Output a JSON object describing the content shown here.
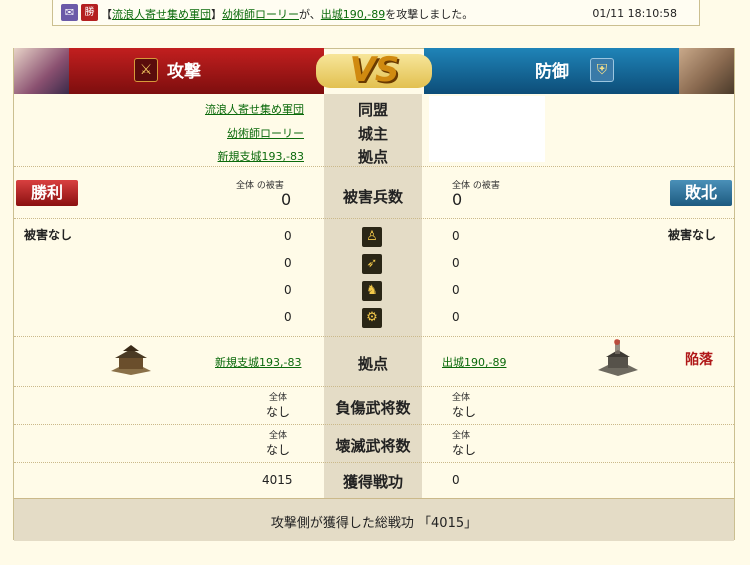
{
  "log": {
    "icon_mail": "✉",
    "icon_win": "勝",
    "prefix": "【",
    "alliance": "流浪人寄せ集め軍団",
    "suffix": "】",
    "player": "幼術師ローリー",
    "connector": "が、",
    "target": "出城190,-89",
    "tail": "を攻撃しました。",
    "timestamp": "01/11 18:10:58"
  },
  "header": {
    "attack_label": "攻撃",
    "defense_label": "防御",
    "vs": "VS",
    "attack_icon": "crossed-swords-icon",
    "defense_icon": "shield-icon"
  },
  "info": {
    "alliance_label": "同盟",
    "lord_label": "城主",
    "base_label": "拠点",
    "attacker_alliance": "流浪人寄せ集め軍団",
    "attacker_lord": "幼術師ローリー",
    "attacker_base": "新規支城193,-83"
  },
  "casualties": {
    "label": "被害兵数",
    "attacker_result": "勝利",
    "defender_result": "敗北",
    "total_label_left": "全体 の被害",
    "total_label_right": "全体 の被害",
    "attacker_total": "0",
    "defender_total": "0"
  },
  "units": {
    "attacker_note": "被害なし",
    "defender_note": "被害なし",
    "rows": [
      {
        "icon": "spearman-icon",
        "glyph": "♙",
        "attacker": "0",
        "defender": "0"
      },
      {
        "icon": "archer-icon",
        "glyph": "➶",
        "attacker": "0",
        "defender": "0"
      },
      {
        "icon": "cavalry-icon",
        "glyph": "♞",
        "attacker": "0",
        "defender": "0"
      },
      {
        "icon": "siege-icon",
        "glyph": "⚙",
        "attacker": "0",
        "defender": "0"
      }
    ]
  },
  "base": {
    "label": "拠点",
    "attacker_base": "新規支城193,-83",
    "defender_base": "出城190,-89",
    "status": "陥落"
  },
  "wounded": {
    "label": "負傷武将数",
    "total_left": "全体",
    "total_right": "全体",
    "attacker": "なし",
    "defender": "なし"
  },
  "destroyed": {
    "label": "壊滅武将数",
    "total_left": "全体",
    "total_right": "全体",
    "attacker": "なし",
    "defender": "なし"
  },
  "merit": {
    "label": "獲得戦功",
    "attacker": "4015",
    "defender": "0"
  },
  "footer": {
    "text": "攻撃側が獲得した総戦功 「4015」"
  },
  "colors": {
    "attack_red": "#b01c1c",
    "defense_blue": "#1a6a9a",
    "link_green": "#0b6a0b",
    "vs_gold": "#d08a10"
  }
}
